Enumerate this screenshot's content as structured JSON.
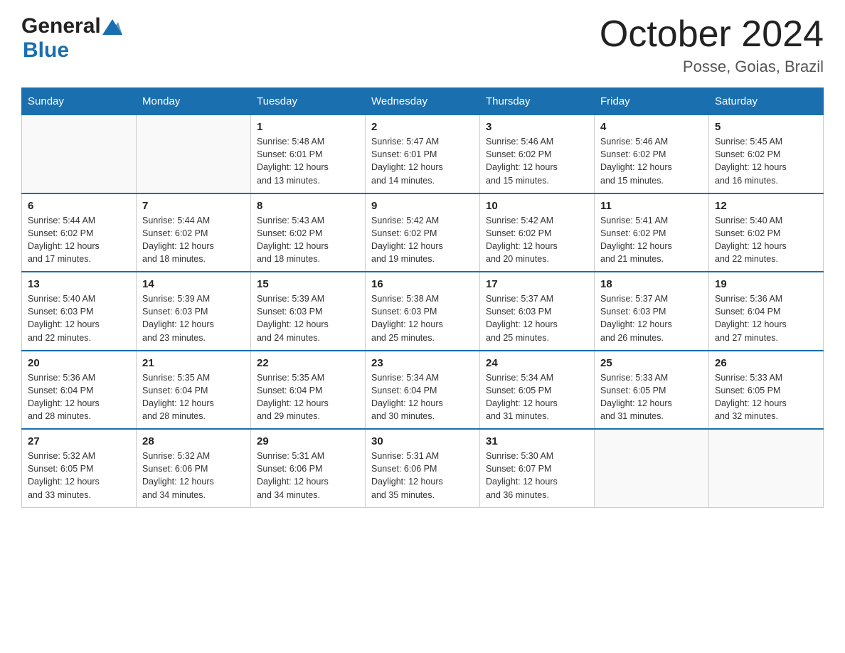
{
  "header": {
    "logo_general": "General",
    "logo_blue": "Blue",
    "month_title": "October 2024",
    "location": "Posse, Goias, Brazil"
  },
  "weekdays": [
    "Sunday",
    "Monday",
    "Tuesday",
    "Wednesday",
    "Thursday",
    "Friday",
    "Saturday"
  ],
  "weeks": [
    [
      {
        "day": "",
        "info": ""
      },
      {
        "day": "",
        "info": ""
      },
      {
        "day": "1",
        "info": "Sunrise: 5:48 AM\nSunset: 6:01 PM\nDaylight: 12 hours\nand 13 minutes."
      },
      {
        "day": "2",
        "info": "Sunrise: 5:47 AM\nSunset: 6:01 PM\nDaylight: 12 hours\nand 14 minutes."
      },
      {
        "day": "3",
        "info": "Sunrise: 5:46 AM\nSunset: 6:02 PM\nDaylight: 12 hours\nand 15 minutes."
      },
      {
        "day": "4",
        "info": "Sunrise: 5:46 AM\nSunset: 6:02 PM\nDaylight: 12 hours\nand 15 minutes."
      },
      {
        "day": "5",
        "info": "Sunrise: 5:45 AM\nSunset: 6:02 PM\nDaylight: 12 hours\nand 16 minutes."
      }
    ],
    [
      {
        "day": "6",
        "info": "Sunrise: 5:44 AM\nSunset: 6:02 PM\nDaylight: 12 hours\nand 17 minutes."
      },
      {
        "day": "7",
        "info": "Sunrise: 5:44 AM\nSunset: 6:02 PM\nDaylight: 12 hours\nand 18 minutes."
      },
      {
        "day": "8",
        "info": "Sunrise: 5:43 AM\nSunset: 6:02 PM\nDaylight: 12 hours\nand 18 minutes."
      },
      {
        "day": "9",
        "info": "Sunrise: 5:42 AM\nSunset: 6:02 PM\nDaylight: 12 hours\nand 19 minutes."
      },
      {
        "day": "10",
        "info": "Sunrise: 5:42 AM\nSunset: 6:02 PM\nDaylight: 12 hours\nand 20 minutes."
      },
      {
        "day": "11",
        "info": "Sunrise: 5:41 AM\nSunset: 6:02 PM\nDaylight: 12 hours\nand 21 minutes."
      },
      {
        "day": "12",
        "info": "Sunrise: 5:40 AM\nSunset: 6:02 PM\nDaylight: 12 hours\nand 22 minutes."
      }
    ],
    [
      {
        "day": "13",
        "info": "Sunrise: 5:40 AM\nSunset: 6:03 PM\nDaylight: 12 hours\nand 22 minutes."
      },
      {
        "day": "14",
        "info": "Sunrise: 5:39 AM\nSunset: 6:03 PM\nDaylight: 12 hours\nand 23 minutes."
      },
      {
        "day": "15",
        "info": "Sunrise: 5:39 AM\nSunset: 6:03 PM\nDaylight: 12 hours\nand 24 minutes."
      },
      {
        "day": "16",
        "info": "Sunrise: 5:38 AM\nSunset: 6:03 PM\nDaylight: 12 hours\nand 25 minutes."
      },
      {
        "day": "17",
        "info": "Sunrise: 5:37 AM\nSunset: 6:03 PM\nDaylight: 12 hours\nand 25 minutes."
      },
      {
        "day": "18",
        "info": "Sunrise: 5:37 AM\nSunset: 6:03 PM\nDaylight: 12 hours\nand 26 minutes."
      },
      {
        "day": "19",
        "info": "Sunrise: 5:36 AM\nSunset: 6:04 PM\nDaylight: 12 hours\nand 27 minutes."
      }
    ],
    [
      {
        "day": "20",
        "info": "Sunrise: 5:36 AM\nSunset: 6:04 PM\nDaylight: 12 hours\nand 28 minutes."
      },
      {
        "day": "21",
        "info": "Sunrise: 5:35 AM\nSunset: 6:04 PM\nDaylight: 12 hours\nand 28 minutes."
      },
      {
        "day": "22",
        "info": "Sunrise: 5:35 AM\nSunset: 6:04 PM\nDaylight: 12 hours\nand 29 minutes."
      },
      {
        "day": "23",
        "info": "Sunrise: 5:34 AM\nSunset: 6:04 PM\nDaylight: 12 hours\nand 30 minutes."
      },
      {
        "day": "24",
        "info": "Sunrise: 5:34 AM\nSunset: 6:05 PM\nDaylight: 12 hours\nand 31 minutes."
      },
      {
        "day": "25",
        "info": "Sunrise: 5:33 AM\nSunset: 6:05 PM\nDaylight: 12 hours\nand 31 minutes."
      },
      {
        "day": "26",
        "info": "Sunrise: 5:33 AM\nSunset: 6:05 PM\nDaylight: 12 hours\nand 32 minutes."
      }
    ],
    [
      {
        "day": "27",
        "info": "Sunrise: 5:32 AM\nSunset: 6:05 PM\nDaylight: 12 hours\nand 33 minutes."
      },
      {
        "day": "28",
        "info": "Sunrise: 5:32 AM\nSunset: 6:06 PM\nDaylight: 12 hours\nand 34 minutes."
      },
      {
        "day": "29",
        "info": "Sunrise: 5:31 AM\nSunset: 6:06 PM\nDaylight: 12 hours\nand 34 minutes."
      },
      {
        "day": "30",
        "info": "Sunrise: 5:31 AM\nSunset: 6:06 PM\nDaylight: 12 hours\nand 35 minutes."
      },
      {
        "day": "31",
        "info": "Sunrise: 5:30 AM\nSunset: 6:07 PM\nDaylight: 12 hours\nand 36 minutes."
      },
      {
        "day": "",
        "info": ""
      },
      {
        "day": "",
        "info": ""
      }
    ]
  ]
}
